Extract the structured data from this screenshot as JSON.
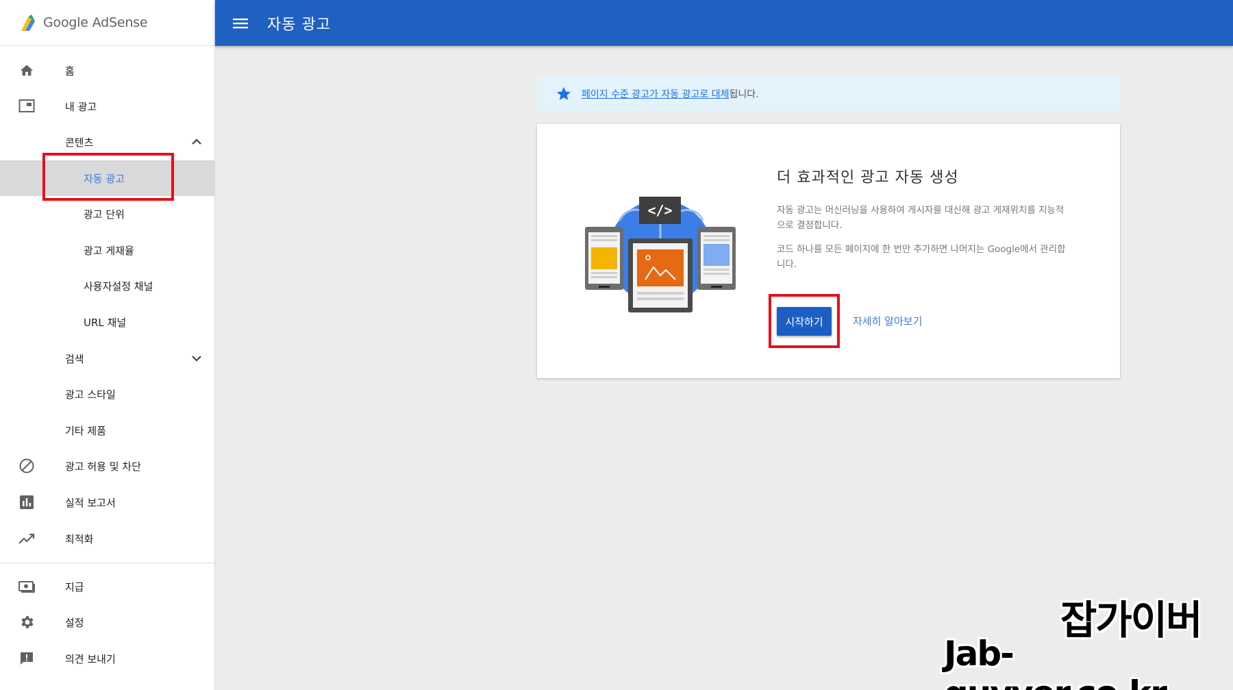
{
  "app": {
    "brand": "Google AdSense",
    "page_title": "자동 광고"
  },
  "sidebar": {
    "items": [
      {
        "label": "홈",
        "icon": "home-icon"
      },
      {
        "label": "내 광고",
        "icon": "ad-units-icon"
      },
      {
        "label": "콘텐츠",
        "expanded": true
      },
      {
        "label": "자동 광고",
        "active": true
      },
      {
        "label": "광고 단위"
      },
      {
        "label": "광고 게재율"
      },
      {
        "label": "사용자설정 채널"
      },
      {
        "label": "URL 채널"
      },
      {
        "label": "검색",
        "expanded": false
      },
      {
        "label": "광고 스타일"
      },
      {
        "label": "기타 제품"
      },
      {
        "label": "광고 허용 및 차단",
        "icon": "block-icon"
      },
      {
        "label": "실적 보고서",
        "icon": "bar-chart-icon"
      },
      {
        "label": "최적화",
        "icon": "trending-up-icon"
      },
      {
        "label": "지급",
        "icon": "payments-icon"
      },
      {
        "label": "설정",
        "icon": "gear-icon"
      },
      {
        "label": "의견 보내기",
        "icon": "feedback-icon"
      }
    ]
  },
  "notice": {
    "link_text": "페이지 수준 광고가 자동 광고로 대체",
    "suffix": "됩니다."
  },
  "card": {
    "title": "더 효과적인 광고 자동 생성",
    "description_1": "자동 광고는 머신러닝을 사용하여 게시자를 대신해 광고 게재위치를 지능적으로 결정합니다.",
    "description_2": "코드 하나를 모든 페이지에 한 번만 추가하면 나머지는 Google에서 관리합니다.",
    "start_button": "시작하기",
    "learn_more": "자세히 알아보기",
    "code_glyph": "</>"
  },
  "watermark": {
    "name": "잡가이버",
    "url": "Jab-guyver.co.kr"
  },
  "colors": {
    "appbar": "#1f60c1",
    "accent": "#3a7be0",
    "highlight": "#e5101a"
  }
}
